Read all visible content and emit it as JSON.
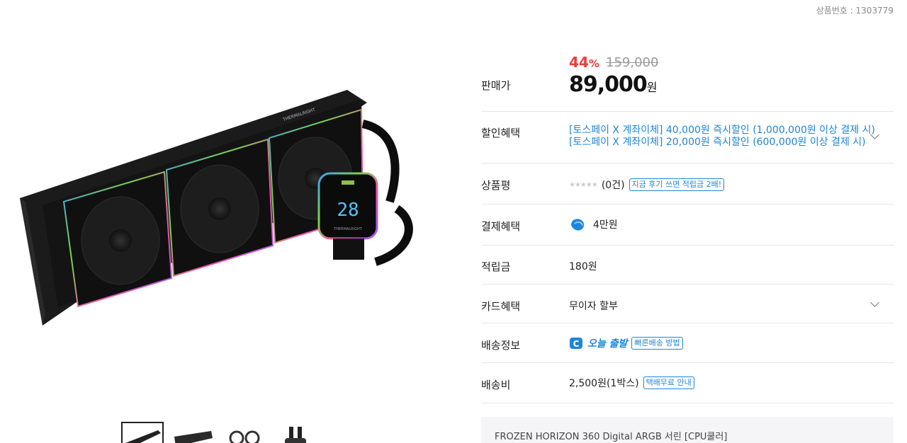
{
  "product_no": "상품번호 : 1303779",
  "price": {
    "label": "판매가",
    "discount_num": "44",
    "discount_pct": "%",
    "original": "159,000",
    "sale": "89,000",
    "won": "원"
  },
  "discount_benefit": {
    "label": "할인혜택",
    "lines": [
      "[토스페이 X 계좌이체] 40,000원 즉시할인 (1,000,000원 이상 결제 시)",
      "[토스페이 X 계좌이체] 20,000원 즉시할인 (600,000원 이상 결제 시)"
    ]
  },
  "review": {
    "label": "상품평",
    "stars": "★★★★★",
    "rating_fraction": 0,
    "count": "(0건)",
    "tag": "지금 후기 쓰면 적립금 2배!"
  },
  "payment": {
    "label": "결제혜택",
    "value": "4만원"
  },
  "points": {
    "label": "적립금",
    "value": "180원"
  },
  "card": {
    "label": "카드혜택",
    "value": "무이자 할부"
  },
  "shipping": {
    "label": "배송정보",
    "today": "오늘 출발",
    "tag": "빠른배송 방법"
  },
  "fee": {
    "label": "배송비",
    "value": "2,500원(1박스)",
    "tag": "택배무료 안내"
  },
  "option_name": "FROZEN HORIZON 360 Digital ARGB 서린 [CPU쿨러]",
  "lcd_reading": "28",
  "brand_text": "THERMALRIGHT",
  "colors": {
    "accent_red": "#f13b3b",
    "accent_blue": "#1e86d8"
  }
}
